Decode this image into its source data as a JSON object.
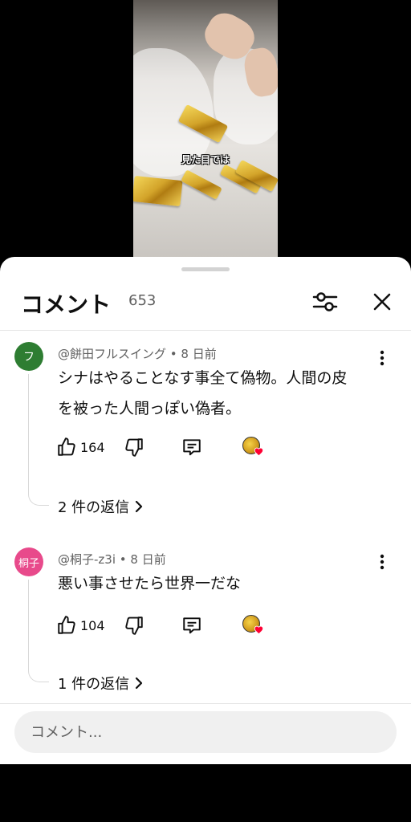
{
  "video": {
    "caption": "見た目では"
  },
  "sheet": {
    "title": "コメント",
    "count": "653",
    "filter_icon": "tune-icon",
    "close_icon": "close-icon"
  },
  "comments": [
    {
      "avatar_letter": "フ",
      "avatar_color": "#2e7d32",
      "handle_time": "@餅田フルスイング • 8 日前",
      "text_line1": "シナはやることなす事全て偽物。人間の皮",
      "text_line2": "を被った人間っぽい偽者。",
      "likes": "164",
      "replies": "2 件の返信"
    },
    {
      "avatar_letter": "桐子",
      "avatar_color": "#e84a8b",
      "handle_time": "@桐子-z3i • 8 日前",
      "text_line1": "悪い事させたら世界一だな",
      "likes": "104",
      "replies": "1 件の返信"
    }
  ],
  "input": {
    "placeholder": "コメント..."
  },
  "colors": {
    "heart": "#ff0033",
    "text": "#0f0f0f",
    "secondary": "#606060"
  }
}
